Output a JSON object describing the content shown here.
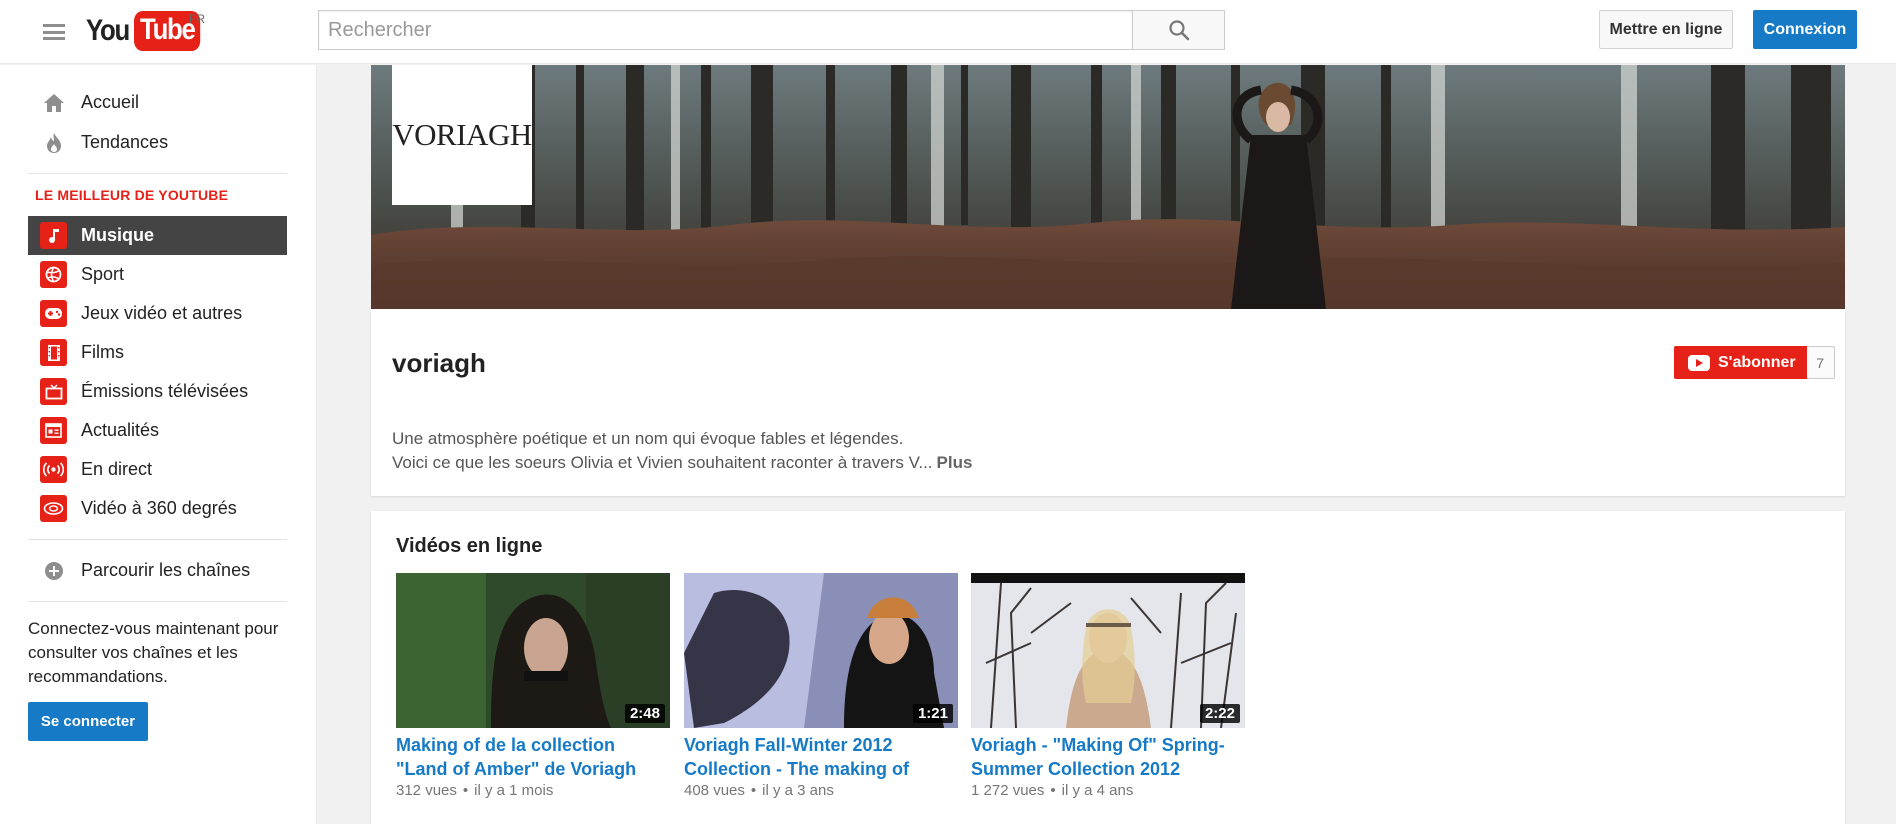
{
  "header": {
    "logo_you": "You",
    "logo_tube": "Tube",
    "region": "FR",
    "search_placeholder": "Rechercher",
    "upload_label": "Mettre en ligne",
    "signin_label": "Connexion"
  },
  "sidebar": {
    "top_items": [
      {
        "label": "Accueil",
        "icon": "home-icon"
      },
      {
        "label": "Tendances",
        "icon": "flame-icon"
      }
    ],
    "best_of_heading": "LE MEILLEUR DE YOUTUBE",
    "best_of_items": [
      {
        "label": "Musique",
        "icon": "music-note-icon",
        "active": true
      },
      {
        "label": "Sport",
        "icon": "ball-icon"
      },
      {
        "label": "Jeux vidéo et autres",
        "icon": "gamepad-icon"
      },
      {
        "label": "Films",
        "icon": "film-icon"
      },
      {
        "label": "Émissions télévisées",
        "icon": "tv-icon"
      },
      {
        "label": "Actualités",
        "icon": "news-icon"
      },
      {
        "label": "En direct",
        "icon": "live-icon"
      },
      {
        "label": "Vidéo à 360 degrés",
        "icon": "360-icon"
      }
    ],
    "browse_channels": "Parcourir les chaînes",
    "promo_text": "Connectez-vous maintenant pour consulter vos chaînes et les recommandations.",
    "promo_button": "Se connecter"
  },
  "channel": {
    "avatar_text": "VORIAGH",
    "name": "voriagh",
    "subscribe_label": "S'abonner",
    "subscriber_count": "7",
    "description_line1": "Une atmosphère poétique et un nom qui évoque fables et légendes.",
    "description_line2": "Voici ce que les soeurs Olivia et Vivien souhaitent raconter à travers V...",
    "more_label": "Plus"
  },
  "shelf": {
    "title": "Vidéos en ligne",
    "videos": [
      {
        "title": "Making of de la collection \"Land of Amber\" de Voriagh Paris",
        "duration": "2:48",
        "views": "312 vues",
        "age": "il y a 1 mois"
      },
      {
        "title": "Voriagh Fall-Winter 2012 Collection - The making of",
        "duration": "1:21",
        "views": "408 vues",
        "age": "il y a 3 ans"
      },
      {
        "title": "Voriagh - \"Making Of\" Spring-Summer Collection 2012",
        "duration": "2:22",
        "views": "1 272 vues",
        "age": "il y a 4 ans"
      }
    ]
  },
  "colors": {
    "brand_red": "#e62117",
    "link_blue": "#167ac6",
    "active_bg": "#444444"
  }
}
